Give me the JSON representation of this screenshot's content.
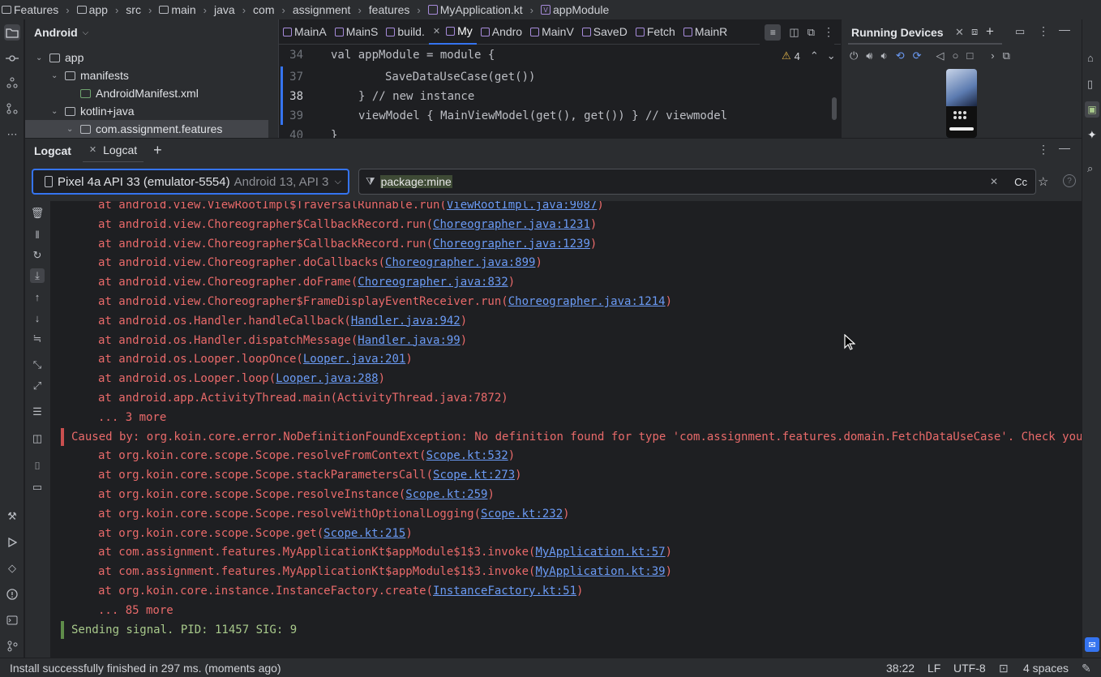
{
  "breadcrumbs": [
    "Features",
    "app",
    "src",
    "main",
    "java",
    "com",
    "assignment",
    "features",
    "MyApplication.kt",
    "appModule"
  ],
  "project": {
    "view": "Android",
    "tree": [
      {
        "label": "app",
        "depth": 0,
        "expanded": true,
        "icon": "module-folder-icon"
      },
      {
        "label": "manifests",
        "depth": 1,
        "expanded": true,
        "icon": "folder-icon"
      },
      {
        "label": "AndroidManifest.xml",
        "depth": 2,
        "expanded": null,
        "icon": "manifest-file-icon"
      },
      {
        "label": "kotlin+java",
        "depth": 1,
        "expanded": true,
        "icon": "folder-icon"
      },
      {
        "label": "com.assignment.features",
        "depth": 2,
        "expanded": true,
        "icon": "package-icon",
        "selected": true
      }
    ]
  },
  "editor": {
    "tabs": [
      "MainA",
      "MainS",
      "build.",
      "My",
      "Andro",
      "MainV",
      "SaveD",
      "Fetch",
      "MainR"
    ],
    "active_tab": "My",
    "warnings": "4",
    "lines": [
      {
        "num": "34",
        "text": "val appModule = module {"
      },
      {
        "num": "37",
        "text": "SaveDataUseCase(get())"
      },
      {
        "num": "38",
        "text": "} // new instance"
      },
      {
        "num": "39",
        "text": "viewModel { MainViewModel(get(), get()) } // viewmodel"
      },
      {
        "num": "40",
        "text": "}"
      }
    ]
  },
  "devices": {
    "title": "Running Devices"
  },
  "logcat": {
    "panel_title": "Logcat",
    "tab_label": "Logcat",
    "device_name": "Pixel 4a API 33 (emulator-5554)",
    "device_info": "Android 13, API 3",
    "filter": "package:mine",
    "case_label": "Cc",
    "lines": [
      {
        "kind": "at",
        "pre": "at android.view.ViewRootImpl$TraversalRunnable.run(",
        "link": "ViewRootImpl.java:9087",
        "post": ")"
      },
      {
        "kind": "at",
        "pre": "at android.view.Choreographer$CallbackRecord.run(",
        "link": "Choreographer.java:1231",
        "post": ")"
      },
      {
        "kind": "at",
        "pre": "at android.view.Choreographer$CallbackRecord.run(",
        "link": "Choreographer.java:1239",
        "post": ")"
      },
      {
        "kind": "at",
        "pre": "at android.view.Choreographer.doCallbacks(",
        "link": "Choreographer.java:899",
        "post": ")"
      },
      {
        "kind": "at",
        "pre": "at android.view.Choreographer.doFrame(",
        "link": "Choreographer.java:832",
        "post": ")"
      },
      {
        "kind": "at",
        "pre": "at android.view.Choreographer$FrameDisplayEventReceiver.run(",
        "link": "Choreographer.java:1214",
        "post": ")"
      },
      {
        "kind": "at",
        "pre": "at android.os.Handler.handleCallback(",
        "link": "Handler.java:942",
        "post": ")"
      },
      {
        "kind": "at",
        "pre": "at android.os.Handler.dispatchMessage(",
        "link": "Handler.java:99",
        "post": ")"
      },
      {
        "kind": "at",
        "pre": "at android.os.Looper.loopOnce(",
        "link": "Looper.java:201",
        "post": ")"
      },
      {
        "kind": "at",
        "pre": "at android.os.Looper.loop(",
        "link": "Looper.java:288",
        "post": ")"
      },
      {
        "kind": "at",
        "pre": "at android.app.ActivityThread.main(ActivityThread.java:7872)",
        "link": "",
        "post": ""
      },
      {
        "kind": "at",
        "pre": "... 3 more",
        "link": "",
        "post": ""
      },
      {
        "kind": "caused",
        "pre": "Caused by: org.koin.core.error.NoDefinitionFoundException: No definition found for type 'com.assignment.features.domain.FetchDataUseCase'. Check your",
        "link": "",
        "post": ""
      },
      {
        "kind": "at",
        "pre": "at org.koin.core.scope.Scope.resolveFromContext(",
        "link": "Scope.kt:532",
        "post": ")"
      },
      {
        "kind": "at",
        "pre": "at org.koin.core.scope.Scope.stackParametersCall(",
        "link": "Scope.kt:273",
        "post": ")"
      },
      {
        "kind": "at",
        "pre": "at org.koin.core.scope.Scope.resolveInstance(",
        "link": "Scope.kt:259",
        "post": ")"
      },
      {
        "kind": "at",
        "pre": "at org.koin.core.scope.Scope.resolveWithOptionalLogging(",
        "link": "Scope.kt:232",
        "post": ")"
      },
      {
        "kind": "at",
        "pre": "at org.koin.core.scope.Scope.get(",
        "link": "Scope.kt:215",
        "post": ")"
      },
      {
        "kind": "at",
        "pre": "at com.assignment.features.MyApplicationKt$appModule$1$3.invoke(",
        "link": "MyApplication.kt:57",
        "post": ")"
      },
      {
        "kind": "at",
        "pre": "at com.assignment.features.MyApplicationKt$appModule$1$3.invoke(",
        "link": "MyApplication.kt:39",
        "post": ")"
      },
      {
        "kind": "at",
        "pre": "at org.koin.core.instance.InstanceFactory.create(",
        "link": "InstanceFactory.kt:51",
        "post": ")"
      },
      {
        "kind": "at",
        "pre": "... 85 more",
        "link": "",
        "post": ""
      },
      {
        "kind": "signal",
        "pre": "Sending signal. PID: 11457 SIG: 9",
        "link": "",
        "post": ""
      }
    ]
  },
  "status": {
    "message": "Install successfully finished in 297 ms. (moments ago)",
    "position": "38:22",
    "line_sep": "LF",
    "encoding": "UTF-8",
    "indent": "4 spaces"
  },
  "colors": {
    "error_text": "#e96a6a",
    "link": "#6b9bf5",
    "info_text": "#a8c98b",
    "accent": "#3574f0"
  }
}
